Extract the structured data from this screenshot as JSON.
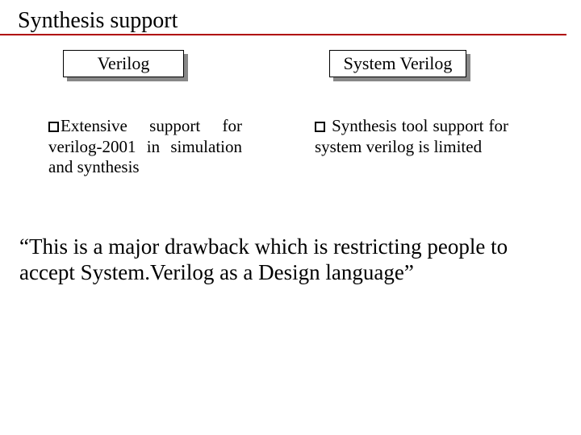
{
  "title": "Synthesis support",
  "left": {
    "heading": "Verilog",
    "bullet": "Extensive support for verilog-2001 in simulation and synthesis"
  },
  "right": {
    "heading": "System Verilog",
    "bullet": "Synthesis tool support for system verilog is limited"
  },
  "quote": "“This is a major drawback which is restricting people to accept System.Verilog as a Design language”"
}
